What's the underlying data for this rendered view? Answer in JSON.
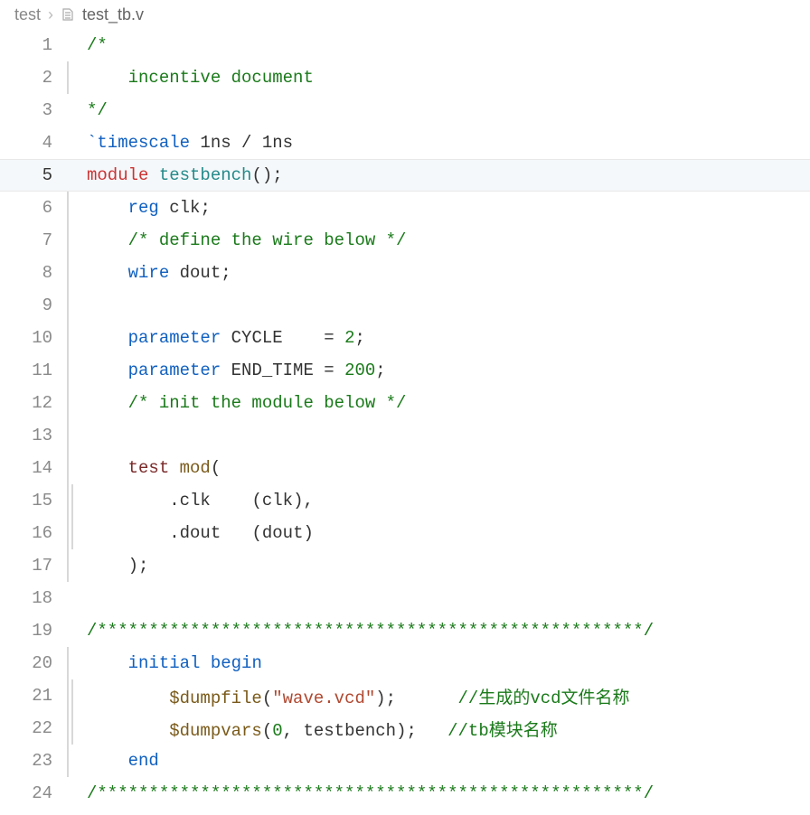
{
  "breadcrumb": {
    "folder": "test",
    "separator": "›",
    "file": "test_tb.v"
  },
  "highlighted_line": 5,
  "lines": [
    {
      "n": 1,
      "bars": 0,
      "tokens": [
        {
          "cls": "c-comment",
          "t": "/*"
        }
      ]
    },
    {
      "n": 2,
      "bars": 1,
      "tokens": [
        {
          "cls": "",
          "t": "    "
        },
        {
          "cls": "c-comment",
          "t": "incentive document"
        }
      ]
    },
    {
      "n": 3,
      "bars": 0,
      "tokens": [
        {
          "cls": "c-comment",
          "t": "*/"
        }
      ]
    },
    {
      "n": 4,
      "bars": 0,
      "tokens": [
        {
          "cls": "c-kw",
          "t": "`timescale"
        },
        {
          "cls": "",
          "t": " 1ns "
        },
        {
          "cls": "c-op",
          "t": "/"
        },
        {
          "cls": "",
          "t": " 1ns"
        }
      ]
    },
    {
      "n": 5,
      "bars": 0,
      "tokens": [
        {
          "cls": "c-module",
          "t": "module"
        },
        {
          "cls": "",
          "t": " "
        },
        {
          "cls": "c-type",
          "t": "testbench"
        },
        {
          "cls": "c-op",
          "t": "();"
        }
      ]
    },
    {
      "n": 6,
      "bars": 1,
      "tokens": [
        {
          "cls": "",
          "t": "    "
        },
        {
          "cls": "c-kw",
          "t": "reg"
        },
        {
          "cls": "",
          "t": " clk"
        },
        {
          "cls": "c-op",
          "t": ";"
        }
      ]
    },
    {
      "n": 7,
      "bars": 1,
      "tokens": [
        {
          "cls": "",
          "t": "    "
        },
        {
          "cls": "c-comment",
          "t": "/* define the wire below */"
        }
      ]
    },
    {
      "n": 8,
      "bars": 1,
      "tokens": [
        {
          "cls": "",
          "t": "    "
        },
        {
          "cls": "c-kw",
          "t": "wire"
        },
        {
          "cls": "",
          "t": " dout"
        },
        {
          "cls": "c-op",
          "t": ";"
        }
      ]
    },
    {
      "n": 9,
      "bars": 1,
      "tokens": []
    },
    {
      "n": 10,
      "bars": 1,
      "tokens": [
        {
          "cls": "",
          "t": "    "
        },
        {
          "cls": "c-kw",
          "t": "parameter"
        },
        {
          "cls": "",
          "t": " CYCLE    "
        },
        {
          "cls": "c-op",
          "t": "="
        },
        {
          "cls": "",
          "t": " "
        },
        {
          "cls": "c-num",
          "t": "2"
        },
        {
          "cls": "c-op",
          "t": ";"
        }
      ]
    },
    {
      "n": 11,
      "bars": 1,
      "tokens": [
        {
          "cls": "",
          "t": "    "
        },
        {
          "cls": "c-kw",
          "t": "parameter"
        },
        {
          "cls": "",
          "t": " END_TIME "
        },
        {
          "cls": "c-op",
          "t": "="
        },
        {
          "cls": "",
          "t": " "
        },
        {
          "cls": "c-num",
          "t": "200"
        },
        {
          "cls": "c-op",
          "t": ";"
        }
      ]
    },
    {
      "n": 12,
      "bars": 1,
      "tokens": [
        {
          "cls": "",
          "t": "    "
        },
        {
          "cls": "c-comment",
          "t": "/* init the module below */"
        }
      ]
    },
    {
      "n": 13,
      "bars": 1,
      "tokens": []
    },
    {
      "n": 14,
      "bars": 1,
      "tokens": [
        {
          "cls": "",
          "t": "    "
        },
        {
          "cls": "c-test",
          "t": "test"
        },
        {
          "cls": "",
          "t": " "
        },
        {
          "cls": "c-fn",
          "t": "mod"
        },
        {
          "cls": "c-op",
          "t": "("
        }
      ]
    },
    {
      "n": 15,
      "bars": 2,
      "tokens": [
        {
          "cls": "",
          "t": "        "
        },
        {
          "cls": "c-op",
          "t": "."
        },
        {
          "cls": "",
          "t": "clk    "
        },
        {
          "cls": "c-op",
          "t": "("
        },
        {
          "cls": "",
          "t": "clk"
        },
        {
          "cls": "c-op",
          "t": "),"
        }
      ]
    },
    {
      "n": 16,
      "bars": 2,
      "tokens": [
        {
          "cls": "",
          "t": "        "
        },
        {
          "cls": "c-op",
          "t": "."
        },
        {
          "cls": "",
          "t": "dout   "
        },
        {
          "cls": "c-op",
          "t": "("
        },
        {
          "cls": "",
          "t": "dout"
        },
        {
          "cls": "c-op",
          "t": ")"
        }
      ]
    },
    {
      "n": 17,
      "bars": 1,
      "tokens": [
        {
          "cls": "",
          "t": "    "
        },
        {
          "cls": "c-op",
          "t": ");"
        }
      ]
    },
    {
      "n": 18,
      "bars": 0,
      "tokens": []
    },
    {
      "n": 19,
      "bars": 0,
      "tokens": [
        {
          "cls": "c-comment",
          "t": "/*****************************************************/"
        }
      ]
    },
    {
      "n": 20,
      "bars": 1,
      "tokens": [
        {
          "cls": "",
          "t": "    "
        },
        {
          "cls": "c-kw",
          "t": "initial"
        },
        {
          "cls": "",
          "t": " "
        },
        {
          "cls": "c-kw",
          "t": "begin"
        }
      ]
    },
    {
      "n": 21,
      "bars": 2,
      "tokens": [
        {
          "cls": "",
          "t": "        "
        },
        {
          "cls": "c-fn",
          "t": "$dumpfile"
        },
        {
          "cls": "c-op",
          "t": "("
        },
        {
          "cls": "c-str",
          "t": "\"wave.vcd\""
        },
        {
          "cls": "c-op",
          "t": ");"
        },
        {
          "cls": "",
          "t": "      "
        },
        {
          "cls": "c-comment",
          "t": "//生成的vcd文件名称"
        }
      ]
    },
    {
      "n": 22,
      "bars": 2,
      "tokens": [
        {
          "cls": "",
          "t": "        "
        },
        {
          "cls": "c-fn",
          "t": "$dumpvars"
        },
        {
          "cls": "c-op",
          "t": "("
        },
        {
          "cls": "c-num",
          "t": "0"
        },
        {
          "cls": "c-op",
          "t": ","
        },
        {
          "cls": "",
          "t": " testbench"
        },
        {
          "cls": "c-op",
          "t": ");"
        },
        {
          "cls": "",
          "t": "   "
        },
        {
          "cls": "c-comment",
          "t": "//tb模块名称"
        }
      ]
    },
    {
      "n": 23,
      "bars": 1,
      "tokens": [
        {
          "cls": "",
          "t": "    "
        },
        {
          "cls": "c-kw",
          "t": "end"
        }
      ]
    },
    {
      "n": 24,
      "bars": 0,
      "tokens": [
        {
          "cls": "c-comment",
          "t": "/*****************************************************/"
        }
      ]
    }
  ]
}
